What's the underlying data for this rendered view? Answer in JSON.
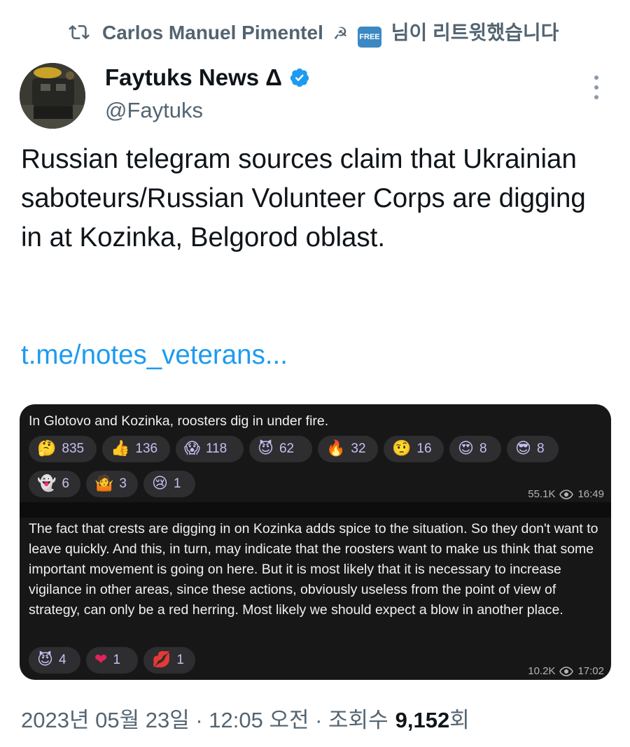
{
  "retweet": {
    "user": "Carlos Manuel Pimentel",
    "hammer_icon": "☭",
    "free_badge": "FREE",
    "suffix": "님이 리트윗했습니다"
  },
  "author": {
    "name": "Faytuks News Δ",
    "handle": "@Faytuks"
  },
  "tweet": {
    "text": "Russian telegram sources claim that Ukrainian saboteurs/Russian Volunteer Corps are digging in at Kozinka, Belgorod oblast.",
    "link": "t.me/notes_veterans..."
  },
  "media": {
    "message1": {
      "text": "In Glotovo and Kozinka, roosters dig in under fire.",
      "reactions": [
        {
          "emoji": "🤔",
          "count": "835"
        },
        {
          "emoji": "👍",
          "count": "136"
        },
        {
          "emoji": "😱",
          "count": "118"
        },
        {
          "emoji": "😈",
          "count": "62"
        },
        {
          "emoji": "🔥",
          "count": "32"
        },
        {
          "emoji": "🤨",
          "count": "16"
        },
        {
          "emoji": "😍",
          "count": "8"
        },
        {
          "emoji": "😎",
          "count": "8"
        },
        {
          "emoji": "👻",
          "count": "6"
        },
        {
          "emoji": "🤷",
          "count": "3"
        },
        {
          "emoji": "😢",
          "count": "1"
        }
      ],
      "views": "55.1K",
      "time": "16:49"
    },
    "message2": {
      "text": "The fact that crests are digging in on Kozinka adds spice to the situation. So they don't want to leave quickly. And this, in turn, may indicate that the roosters want to make us think that some important movement is going on here. But it is most likely that it is necessary to increase vigilance in other areas, since these actions, obviously useless from the point of view of strategy, can only be a red herring. Most likely we should expect a blow in another place.",
      "reactions": [
        {
          "emoji": "😈",
          "count": "4"
        },
        {
          "emoji": "❤",
          "count": "1"
        },
        {
          "emoji": "💋",
          "count": "1"
        }
      ],
      "views": "10.2K",
      "time": "17:02"
    }
  },
  "footer": {
    "date": "2023년 05월 23일 · 12:05 오전 · 조회수",
    "views": "9,152",
    "views_suffix": "회"
  },
  "colors": {
    "link": "#1d9bf0",
    "secondary_text": "#536471",
    "verified": "#1d9bf0",
    "telegram_bg": "#171717",
    "reaction_text": "#c9bef0"
  }
}
